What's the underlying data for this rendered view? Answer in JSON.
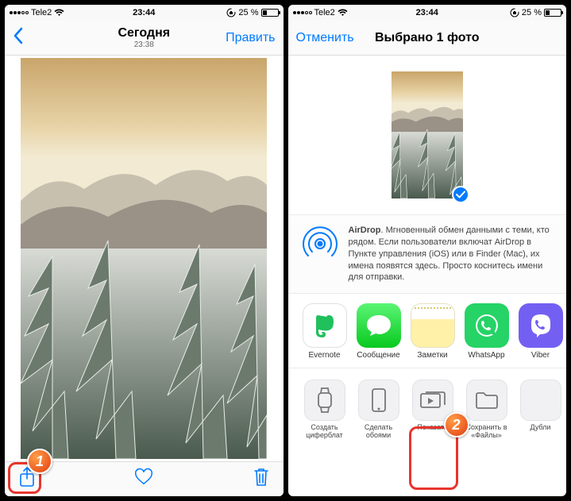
{
  "status": {
    "carrier": "Tele2",
    "time": "23:44",
    "battery_pct": "25 %"
  },
  "left": {
    "nav_title": "Сегодня",
    "nav_subtitle": "23:38",
    "nav_edit": "Править"
  },
  "right": {
    "nav_cancel": "Отменить",
    "nav_title": "Выбрано 1 фото",
    "airdrop_bold": "AirDrop",
    "airdrop_text": ". Мгновенный обмен данными с теми, кто рядом. Если пользователи включат AirDrop в Пункте управления (iOS) или в Finder (Mac), их имена появятся здесь. Просто коснитесь имени для отправки.",
    "apps": [
      "Evernote",
      "Сообщение",
      "Заметки",
      "WhatsApp",
      "Viber"
    ],
    "actions": [
      "Создать циферблат",
      "Сделать обоями",
      "Показать",
      "Сохранить в «Файлы»",
      "Дубли"
    ]
  },
  "annot": {
    "b1": "1",
    "b2": "2"
  }
}
